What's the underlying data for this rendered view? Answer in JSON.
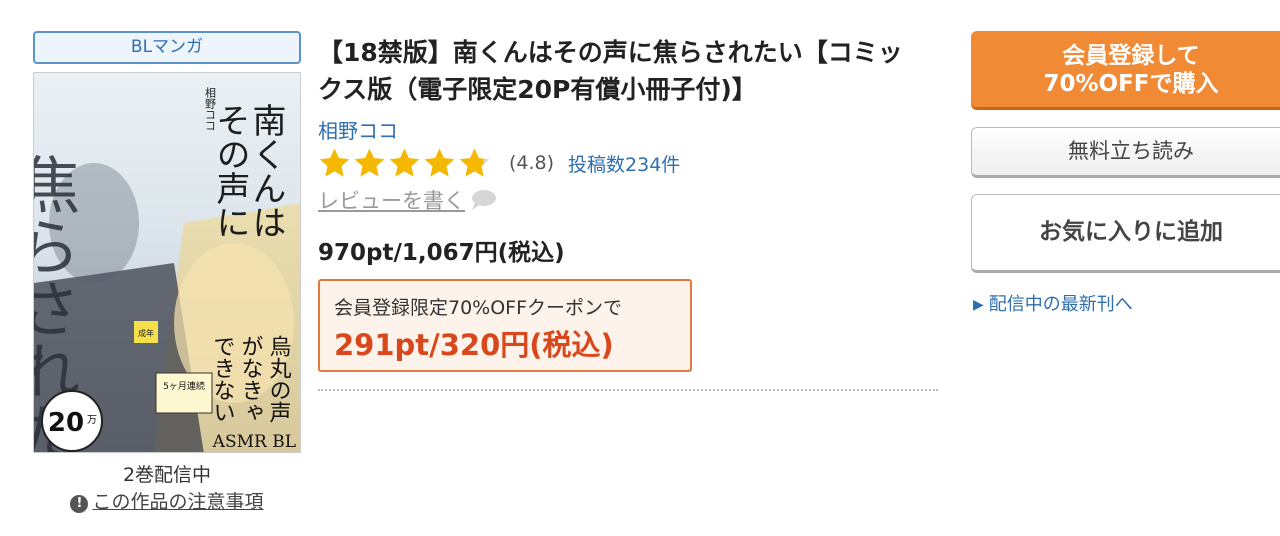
{
  "genre": "BLマンガ",
  "cover": {
    "title_vertical_1": "南くんは",
    "title_vertical_2": "その声に",
    "title_big": "焦らされたい",
    "author_vertical": "相野ココ",
    "tagline_1": "烏丸の声",
    "tagline_2": "がなきゃ",
    "tagline_3": "できない",
    "badge_count": "20",
    "badge_unit": "万",
    "asmr": "ASMR BL",
    "seinen": "成年",
    "fair": "5ヶ月連続"
  },
  "volume_status": "2巻配信中",
  "notice_icon": "exclamation-icon",
  "notice_text": "この作品の注意事項",
  "title": "【18禁版】南くんはその声に焦らされたい【コミックス版（電子限定20P有償小冊子付)】",
  "author": "相野ココ",
  "rating": {
    "stars": 4.8,
    "value_text": "(4.8)",
    "count_text": "投稿数234件",
    "star_color": "#f5b800",
    "empty_color": "#d8d8d8"
  },
  "review_link": "レビューを書く",
  "price": "970pt/1,067円(税込)",
  "coupon": {
    "label": "会員登録限定70%OFFクーポンで",
    "price": "291pt/320円(税込)"
  },
  "buttons": {
    "buy_line1": "会員登録して",
    "buy_line2": "70%OFFで購入",
    "sample": "無料立ち読み",
    "favorite": "お気に入りに追加"
  },
  "latest_link": "配信中の最新刊へ",
  "colors": {
    "accent_orange": "#f08a35",
    "link_blue": "#2d6fb0",
    "coupon_red": "#d9481d"
  }
}
